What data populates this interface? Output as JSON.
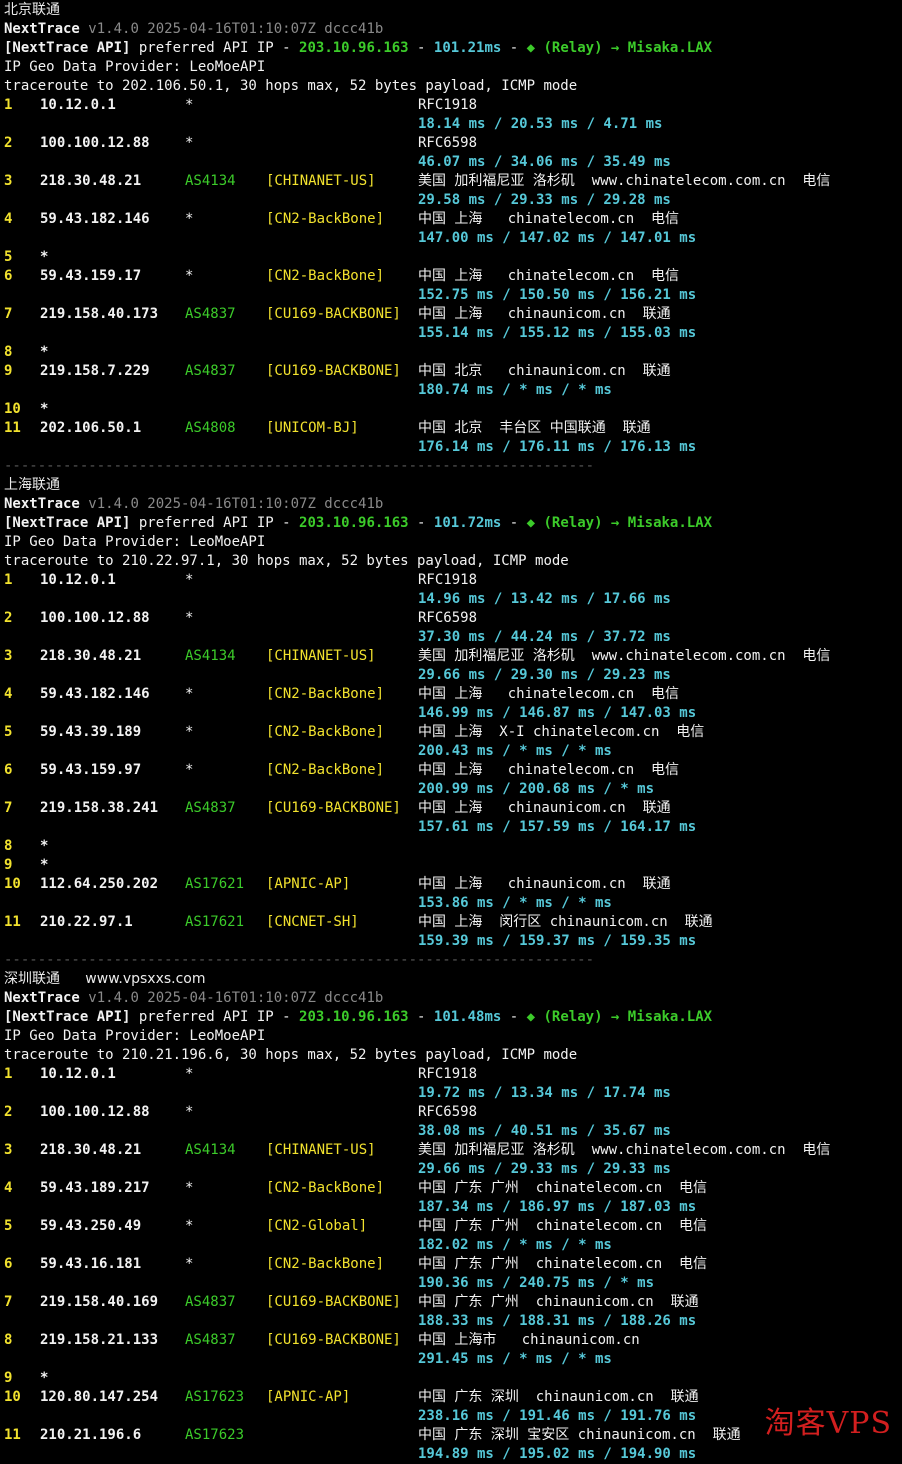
{
  "watermark": "淘客VPS",
  "sections": [
    {
      "title": "北京联通",
      "site": "",
      "app": "NextTrace",
      "version": "v1.4.0 2025-04-16T01:10:07Z dccc41b",
      "api_prefix": "[NextTrace API]",
      "api_pref": "preferred API IP",
      "api_ip": "203.10.96.163",
      "api_ms": "101.21ms",
      "api_route": "(Relay) → Misaka.LAX",
      "geo": "IP Geo Data Provider: LeoMoeAPI",
      "cmd": "traceroute to 202.106.50.1, 30 hops max, 52 bytes payload, ICMP mode",
      "hops": [
        {
          "n": "1",
          "ip": "10.12.0.1",
          "as": "*",
          "net": "",
          "geo": "RFC1918",
          "rtt": "18.14 ms / 20.53 ms / 4.71 ms"
        },
        {
          "n": "2",
          "ip": "100.100.12.88",
          "as": "*",
          "net": "",
          "geo": "RFC6598",
          "rtt": "46.07 ms / 34.06 ms / 35.49 ms"
        },
        {
          "n": "3",
          "ip": "218.30.48.21",
          "as": "AS4134",
          "net": "[CHINANET-US]",
          "geo": "美国 加利福尼亚 洛杉矶  www.chinatelecom.com.cn  电信",
          "rtt": "29.58 ms / 29.33 ms / 29.28 ms"
        },
        {
          "n": "4",
          "ip": "59.43.182.146",
          "as": "*",
          "net": "[CN2-BackBone]",
          "geo": "中国 上海   chinatelecom.cn  电信",
          "rtt": "147.00 ms / 147.02 ms / 147.01 ms"
        },
        {
          "n": "5",
          "ip": "*",
          "as": "",
          "net": "",
          "geo": "",
          "rtt": ""
        },
        {
          "n": "6",
          "ip": "59.43.159.17",
          "as": "*",
          "net": "[CN2-BackBone]",
          "geo": "中国 上海   chinatelecom.cn  电信",
          "rtt": "152.75 ms / 150.50 ms / 156.21 ms"
        },
        {
          "n": "7",
          "ip": "219.158.40.173",
          "as": "AS4837",
          "net": "[CU169-BACKBONE]",
          "geo": "中国 上海   chinaunicom.cn  联通",
          "rtt": "155.14 ms / 155.12 ms / 155.03 ms"
        },
        {
          "n": "8",
          "ip": "*",
          "as": "",
          "net": "",
          "geo": "",
          "rtt": ""
        },
        {
          "n": "9",
          "ip": "219.158.7.229",
          "as": "AS4837",
          "net": "[CU169-BACKBONE]",
          "geo": "中国 北京   chinaunicom.cn  联通",
          "rtt": "180.74 ms / * ms / * ms"
        },
        {
          "n": "10",
          "ip": "*",
          "as": "",
          "net": "",
          "geo": "",
          "rtt": ""
        },
        {
          "n": "11",
          "ip": "202.106.50.1",
          "as": "AS4808",
          "net": "[UNICOM-BJ]",
          "geo": "中国 北京  丰台区 中国联通  联通",
          "rtt": "176.14 ms / 176.11 ms / 176.13 ms"
        }
      ]
    },
    {
      "title": "上海联通",
      "site": "",
      "app": "NextTrace",
      "version": "v1.4.0 2025-04-16T01:10:07Z dccc41b",
      "api_prefix": "[NextTrace API]",
      "api_pref": "preferred API IP",
      "api_ip": "203.10.96.163",
      "api_ms": "101.72ms",
      "api_route": "(Relay) → Misaka.LAX",
      "geo": "IP Geo Data Provider: LeoMoeAPI",
      "cmd": "traceroute to 210.22.97.1, 30 hops max, 52 bytes payload, ICMP mode",
      "hops": [
        {
          "n": "1",
          "ip": "10.12.0.1",
          "as": "*",
          "net": "",
          "geo": "RFC1918",
          "rtt": "14.96 ms / 13.42 ms / 17.66 ms"
        },
        {
          "n": "2",
          "ip": "100.100.12.88",
          "as": "*",
          "net": "",
          "geo": "RFC6598",
          "rtt": "37.30 ms / 44.24 ms / 37.72 ms"
        },
        {
          "n": "3",
          "ip": "218.30.48.21",
          "as": "AS4134",
          "net": "[CHINANET-US]",
          "geo": "美国 加利福尼亚 洛杉矶  www.chinatelecom.com.cn  电信",
          "rtt": "29.66 ms / 29.30 ms / 29.23 ms"
        },
        {
          "n": "4",
          "ip": "59.43.182.146",
          "as": "*",
          "net": "[CN2-BackBone]",
          "geo": "中国 上海   chinatelecom.cn  电信",
          "rtt": "146.99 ms / 146.87 ms / 147.03 ms"
        },
        {
          "n": "5",
          "ip": "59.43.39.189",
          "as": "*",
          "net": "[CN2-BackBone]",
          "geo": "中国 上海  X-I chinatelecom.cn  电信",
          "rtt": "200.43 ms / * ms / * ms"
        },
        {
          "n": "6",
          "ip": "59.43.159.97",
          "as": "*",
          "net": "[CN2-BackBone]",
          "geo": "中国 上海   chinatelecom.cn  电信",
          "rtt": "200.99 ms / 200.68 ms / * ms"
        },
        {
          "n": "7",
          "ip": "219.158.38.241",
          "as": "AS4837",
          "net": "[CU169-BACKBONE]",
          "geo": "中国 上海   chinaunicom.cn  联通",
          "rtt": "157.61 ms / 157.59 ms / 164.17 ms"
        },
        {
          "n": "8",
          "ip": "*",
          "as": "",
          "net": "",
          "geo": "",
          "rtt": ""
        },
        {
          "n": "9",
          "ip": "*",
          "as": "",
          "net": "",
          "geo": "",
          "rtt": ""
        },
        {
          "n": "10",
          "ip": "112.64.250.202",
          "as": "AS17621",
          "net": "[APNIC-AP]",
          "geo": "中国 上海   chinaunicom.cn  联通",
          "rtt": "153.86 ms / * ms / * ms"
        },
        {
          "n": "11",
          "ip": "210.22.97.1",
          "as": "AS17621",
          "net": "[CNCNET-SH]",
          "geo": "中国 上海  闵行区 chinaunicom.cn  联通",
          "rtt": "159.39 ms / 159.37 ms / 159.35 ms"
        }
      ]
    },
    {
      "title": "深圳联通",
      "site": "www.vpsxxs.com",
      "app": "NextTrace",
      "version": "v1.4.0 2025-04-16T01:10:07Z dccc41b",
      "api_prefix": "[NextTrace API]",
      "api_pref": "preferred API IP",
      "api_ip": "203.10.96.163",
      "api_ms": "101.48ms",
      "api_route": "(Relay) → Misaka.LAX",
      "geo": "IP Geo Data Provider: LeoMoeAPI",
      "cmd": "traceroute to 210.21.196.6, 30 hops max, 52 bytes payload, ICMP mode",
      "hops": [
        {
          "n": "1",
          "ip": "10.12.0.1",
          "as": "*",
          "net": "",
          "geo": "RFC1918",
          "rtt": "19.72 ms / 13.34 ms / 17.74 ms"
        },
        {
          "n": "2",
          "ip": "100.100.12.88",
          "as": "*",
          "net": "",
          "geo": "RFC6598",
          "rtt": "38.08 ms / 40.51 ms / 35.67 ms"
        },
        {
          "n": "3",
          "ip": "218.30.48.21",
          "as": "AS4134",
          "net": "[CHINANET-US]",
          "geo": "美国 加利福尼亚 洛杉矶  www.chinatelecom.com.cn  电信",
          "rtt": "29.66 ms / 29.33 ms / 29.33 ms"
        },
        {
          "n": "4",
          "ip": "59.43.189.217",
          "as": "*",
          "net": "[CN2-BackBone]",
          "geo": "中国 广东 广州  chinatelecom.cn  电信",
          "rtt": "187.34 ms / 186.97 ms / 187.03 ms"
        },
        {
          "n": "5",
          "ip": "59.43.250.49",
          "as": "*",
          "net": "[CN2-Global]",
          "geo": "中国 广东 广州  chinatelecom.cn  电信",
          "rtt": "182.02 ms / * ms / * ms"
        },
        {
          "n": "6",
          "ip": "59.43.16.181",
          "as": "*",
          "net": "[CN2-BackBone]",
          "geo": "中国 广东 广州  chinatelecom.cn  电信",
          "rtt": "190.36 ms / 240.75 ms / * ms"
        },
        {
          "n": "7",
          "ip": "219.158.40.169",
          "as": "AS4837",
          "net": "[CU169-BACKBONE]",
          "geo": "中国 广东 广州  chinaunicom.cn  联通",
          "rtt": "188.33 ms / 188.31 ms / 188.26 ms"
        },
        {
          "n": "8",
          "ip": "219.158.21.133",
          "as": "AS4837",
          "net": "[CU169-BACKBONE]",
          "geo": "中国 上海市   chinaunicom.cn",
          "rtt": "291.45 ms / * ms / * ms"
        },
        {
          "n": "9",
          "ip": "*",
          "as": "",
          "net": "",
          "geo": "",
          "rtt": ""
        },
        {
          "n": "10",
          "ip": "120.80.147.254",
          "as": "AS17623",
          "net": "[APNIC-AP]",
          "geo": "中国 广东 深圳  chinaunicom.cn  联通",
          "rtt": "238.16 ms / 191.46 ms / 191.76 ms"
        },
        {
          "n": "11",
          "ip": "210.21.196.6",
          "as": "AS17623",
          "net": "",
          "geo": "中国 广东 深圳 宝安区 chinaunicom.cn  联通",
          "rtt": "194.89 ms / 195.02 ms / 194.90 ms"
        }
      ]
    }
  ],
  "separator": "----------------------------------------------------------------------"
}
